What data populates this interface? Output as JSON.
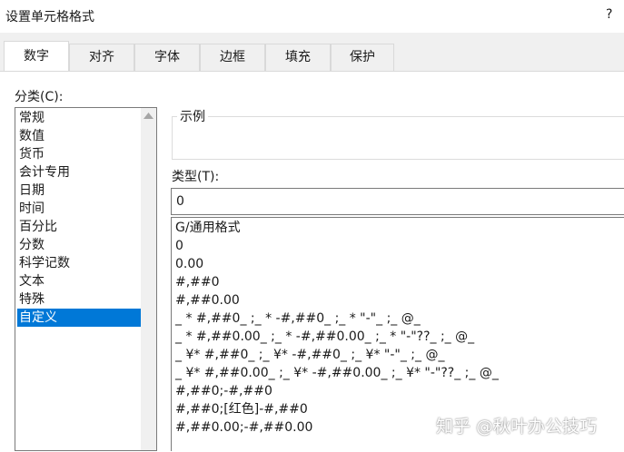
{
  "dialog": {
    "title": "设置单元格格式",
    "help": "?"
  },
  "tabs": [
    {
      "label": "数字",
      "active": true
    },
    {
      "label": "对齐"
    },
    {
      "label": "字体"
    },
    {
      "label": "边框"
    },
    {
      "label": "填充"
    },
    {
      "label": "保护"
    }
  ],
  "category": {
    "label": "分类(C):",
    "items": [
      "常规",
      "数值",
      "货币",
      "会计专用",
      "日期",
      "时间",
      "百分比",
      "分数",
      "科学记数",
      "文本",
      "特殊",
      "自定义"
    ],
    "selected": "自定义"
  },
  "sample": {
    "label": "示例"
  },
  "type": {
    "label": "类型(T):",
    "value": "0",
    "formats": [
      "G/通用格式",
      "0",
      "0.00",
      "#,##0",
      "#,##0.00",
      "_ * #,##0_ ;_ * -#,##0_ ;_ * \"-\"_ ;_ @_",
      "_ * #,##0.00_ ;_ * -#,##0.00_ ;_ * \"-\"??_ ;_ @_",
      "_ ¥* #,##0_ ;_ ¥* -#,##0_ ;_ ¥* \"-\"_ ;_ @_",
      "_ ¥* #,##0.00_ ;_ ¥* -#,##0.00_ ;_ ¥* \"-\"??_ ;_ @_",
      "#,##0;-#,##0",
      "#,##0;[红色]-#,##0",
      "#,##0.00;-#,##0.00"
    ]
  },
  "watermark": "知乎 @秋叶办公技巧",
  "colors": {
    "selection": "#0078d7",
    "tab_bg": "#f0f0f0"
  }
}
